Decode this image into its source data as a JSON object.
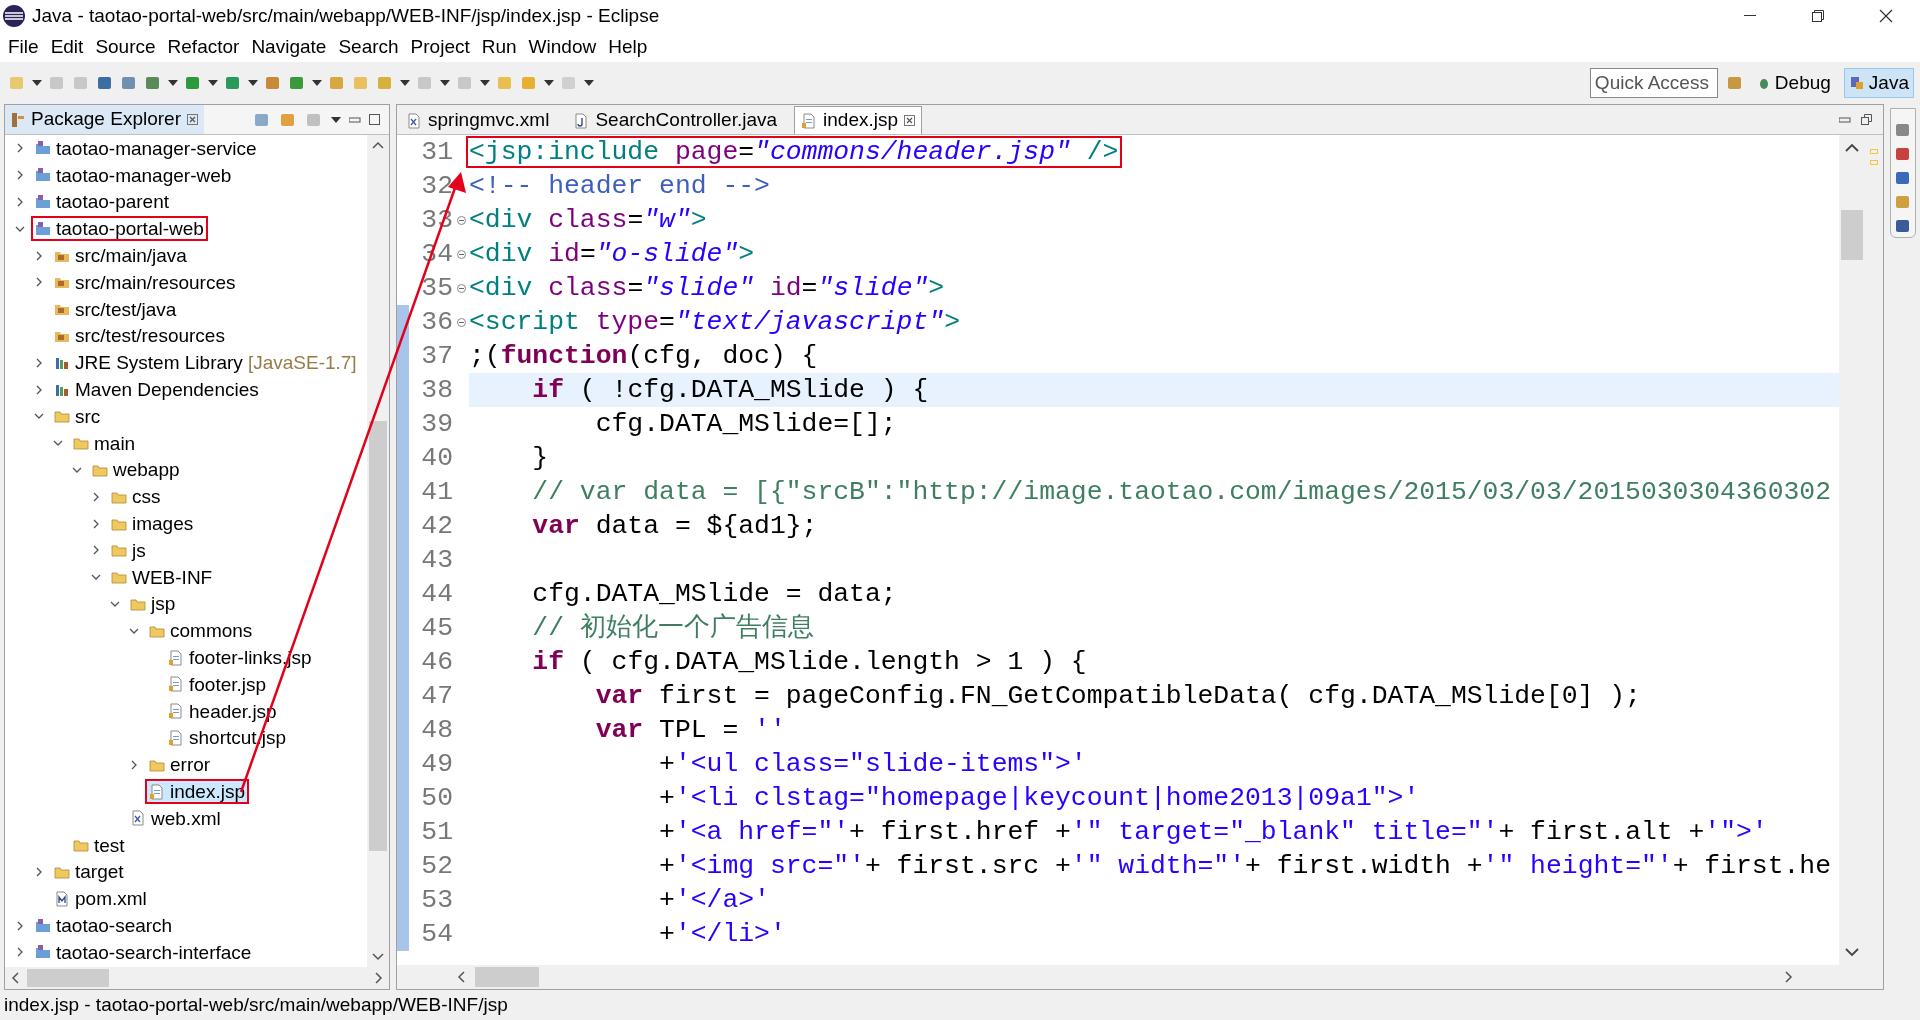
{
  "window": {
    "title": "Java - taotao-portal-web/src/main/webapp/WEB-INF/jsp/index.jsp - Eclipse"
  },
  "menu": [
    "File",
    "Edit",
    "Source",
    "Refactor",
    "Navigate",
    "Search",
    "Project",
    "Run",
    "Window",
    "Help"
  ],
  "quick_access": {
    "placeholder": "Quick Access"
  },
  "perspectives": [
    {
      "label": "Debug",
      "kind": "debug",
      "selected": false
    },
    {
      "label": "Java",
      "kind": "java",
      "selected": true
    }
  ],
  "package_explorer": {
    "title": "Package Explorer",
    "tree": [
      {
        "label": "taotao-manager-service",
        "kind": "project",
        "expanded": false,
        "selected": false,
        "annotated": false
      },
      {
        "label": "taotao-manager-web",
        "kind": "project",
        "expanded": false,
        "selected": false,
        "annotated": false
      },
      {
        "label": "taotao-parent",
        "kind": "project",
        "expanded": false,
        "selected": false,
        "annotated": false
      },
      {
        "label": "taotao-portal-web",
        "kind": "project",
        "expanded": true,
        "selected": false,
        "annotated": true,
        "children": [
          {
            "label": "src/main/java",
            "kind": "source",
            "expanded": false,
            "selected": false,
            "annotated": false
          },
          {
            "label": "src/main/resources",
            "kind": "source",
            "expanded": false,
            "selected": false,
            "annotated": false
          },
          {
            "label": "src/test/java",
            "kind": "source",
            "selected": false,
            "annotated": false
          },
          {
            "label": "src/test/resources",
            "kind": "source",
            "selected": false,
            "annotated": false
          },
          {
            "label": "JRE System Library",
            "decoration": "[JavaSE-1.7]",
            "kind": "library",
            "expanded": false,
            "selected": false,
            "annotated": false
          },
          {
            "label": "Maven Dependencies",
            "kind": "library",
            "expanded": false,
            "selected": false,
            "annotated": false
          },
          {
            "label": "src",
            "kind": "folder",
            "expanded": true,
            "selected": false,
            "annotated": false,
            "children": [
              {
                "label": "main",
                "kind": "folder",
                "expanded": true,
                "selected": false,
                "annotated": false,
                "children": [
                  {
                    "label": "webapp",
                    "kind": "folder",
                    "expanded": true,
                    "selected": false,
                    "annotated": false,
                    "children": [
                      {
                        "label": "css",
                        "kind": "folder",
                        "expanded": false,
                        "selected": false,
                        "annotated": false
                      },
                      {
                        "label": "images",
                        "kind": "folder",
                        "expanded": false,
                        "selected": false,
                        "annotated": false
                      },
                      {
                        "label": "js",
                        "kind": "folder",
                        "expanded": false,
                        "selected": false,
                        "annotated": false
                      },
                      {
                        "label": "WEB-INF",
                        "kind": "folder",
                        "expanded": true,
                        "selected": false,
                        "annotated": false,
                        "children": [
                          {
                            "label": "jsp",
                            "kind": "folder",
                            "expanded": true,
                            "selected": false,
                            "annotated": false,
                            "children": [
                              {
                                "label": "commons",
                                "kind": "folder",
                                "expanded": true,
                                "selected": false,
                                "annotated": false,
                                "children": [
                                  {
                                    "label": "footer-links.jsp",
                                    "kind": "jsp",
                                    "selected": false,
                                    "annotated": false
                                  },
                                  {
                                    "label": "footer.jsp",
                                    "kind": "jsp",
                                    "selected": false,
                                    "annotated": false
                                  },
                                  {
                                    "label": "header.jsp",
                                    "kind": "jsp",
                                    "selected": false,
                                    "annotated": false
                                  },
                                  {
                                    "label": "shortcut.jsp",
                                    "kind": "jsp",
                                    "selected": false,
                                    "annotated": false
                                  }
                                ]
                              },
                              {
                                "label": "error",
                                "kind": "folder",
                                "expanded": false,
                                "selected": false,
                                "annotated": false
                              },
                              {
                                "label": "index.jsp",
                                "kind": "jsp",
                                "selected": true,
                                "annotated": true
                              }
                            ]
                          },
                          {
                            "label": "web.xml",
                            "kind": "xml",
                            "selected": false,
                            "annotated": false
                          }
                        ]
                      }
                    ]
                  }
                ]
              },
              {
                "label": "test",
                "kind": "folder",
                "selected": false,
                "annotated": false
              }
            ]
          },
          {
            "label": "target",
            "kind": "folder",
            "expanded": false,
            "selected": false,
            "annotated": false
          },
          {
            "label": "pom.xml",
            "kind": "pom",
            "selected": false,
            "annotated": false
          }
        ]
      },
      {
        "label": "taotao-search",
        "kind": "project",
        "expanded": false,
        "selected": false,
        "annotated": false
      },
      {
        "label": "taotao-search-interface",
        "kind": "project",
        "expanded": false,
        "selected": false,
        "annotated": false
      }
    ]
  },
  "editor": {
    "tabs": [
      {
        "label": "springmvc.xml",
        "kind": "xml",
        "selected": false
      },
      {
        "label": "SearchController.java",
        "kind": "java",
        "selected": false
      },
      {
        "label": "index.jsp",
        "kind": "jsp",
        "selected": true
      }
    ],
    "lines": [
      {
        "number": "31",
        "current": false,
        "changed": false,
        "foldable": false,
        "annotated": true,
        "tokens": [
          {
            "kind": "tag",
            "text": "<jsp:include"
          },
          {
            "kind": "attr",
            "text": " page"
          },
          {
            "kind": "plain",
            "text": "="
          },
          {
            "kind": "value",
            "text": "\"commons/header.jsp\""
          },
          {
            "kind": "tag",
            "text": " />"
          }
        ]
      },
      {
        "number": "32",
        "current": false,
        "changed": false,
        "foldable": false,
        "annotated": false,
        "tokens": [
          {
            "kind": "markup-comment",
            "text": "<!-- header end -->"
          }
        ]
      },
      {
        "number": "33",
        "current": false,
        "changed": false,
        "foldable": true,
        "annotated": false,
        "tokens": [
          {
            "kind": "tag",
            "text": "<div"
          },
          {
            "kind": "attr",
            "text": " class"
          },
          {
            "kind": "plain",
            "text": "="
          },
          {
            "kind": "value",
            "text": "\"w\""
          },
          {
            "kind": "tag",
            "text": ">"
          }
        ]
      },
      {
        "number": "34",
        "current": false,
        "changed": false,
        "foldable": true,
        "annotated": false,
        "tokens": [
          {
            "kind": "tag",
            "text": "<div"
          },
          {
            "kind": "attr",
            "text": " id"
          },
          {
            "kind": "plain",
            "text": "="
          },
          {
            "kind": "value",
            "text": "\"o-slide\""
          },
          {
            "kind": "tag",
            "text": ">"
          }
        ]
      },
      {
        "number": "35",
        "current": false,
        "changed": false,
        "foldable": true,
        "annotated": false,
        "tokens": [
          {
            "kind": "tag",
            "text": "<div"
          },
          {
            "kind": "attr",
            "text": " class"
          },
          {
            "kind": "plain",
            "text": "="
          },
          {
            "kind": "value",
            "text": "\"slide\""
          },
          {
            "kind": "attr",
            "text": " id"
          },
          {
            "kind": "plain",
            "text": "="
          },
          {
            "kind": "value",
            "text": "\"slide\""
          },
          {
            "kind": "tag",
            "text": ">"
          }
        ]
      },
      {
        "number": "36",
        "current": false,
        "changed": true,
        "foldable": true,
        "annotated": false,
        "tokens": [
          {
            "kind": "tag",
            "text": "<script"
          },
          {
            "kind": "attr",
            "text": " type"
          },
          {
            "kind": "plain",
            "text": "="
          },
          {
            "kind": "value",
            "text": "\"text/javascript\""
          },
          {
            "kind": "tag",
            "text": ">"
          }
        ]
      },
      {
        "number": "37",
        "current": false,
        "changed": true,
        "foldable": false,
        "annotated": false,
        "tokens": [
          {
            "kind": "plain",
            "text": ";("
          },
          {
            "kind": "keyword",
            "text": "function"
          },
          {
            "kind": "plain",
            "text": "(cfg, doc) {"
          }
        ]
      },
      {
        "number": "38",
        "current": true,
        "changed": true,
        "foldable": false,
        "annotated": false,
        "tokens": [
          {
            "kind": "keyword",
            "text": "    if"
          },
          {
            "kind": "plain",
            "text": " ( !cfg.DATA_MSlide ) {"
          }
        ]
      },
      {
        "number": "39",
        "current": false,
        "changed": true,
        "foldable": false,
        "annotated": false,
        "tokens": [
          {
            "kind": "plain",
            "text": "        cfg.DATA_MSlide=[];"
          }
        ]
      },
      {
        "number": "40",
        "current": false,
        "changed": true,
        "foldable": false,
        "annotated": false,
        "tokens": [
          {
            "kind": "plain",
            "text": "    }"
          }
        ]
      },
      {
        "number": "41",
        "current": false,
        "changed": true,
        "foldable": false,
        "annotated": false,
        "tokens": [
          {
            "kind": "comment",
            "text": "    // var data = [{\"srcB\":\"http://image.taotao.com/images/2015/03/03/2015030304360302"
          }
        ]
      },
      {
        "number": "42",
        "current": false,
        "changed": true,
        "foldable": false,
        "annotated": false,
        "tokens": [
          {
            "kind": "keyword",
            "text": "    var"
          },
          {
            "kind": "plain",
            "text": " data = ${ad1};"
          }
        ]
      },
      {
        "number": "43",
        "current": false,
        "changed": true,
        "foldable": false,
        "annotated": false
      },
      {
        "number": "44",
        "current": false,
        "changed": true,
        "foldable": false,
        "annotated": false,
        "tokens": [
          {
            "kind": "plain",
            "text": "    cfg.DATA_MSlide = data;"
          }
        ]
      },
      {
        "number": "45",
        "current": false,
        "changed": true,
        "foldable": false,
        "annotated": false,
        "tokens": [
          {
            "kind": "comment",
            "text": "    // 初始化一个广告信息"
          }
        ]
      },
      {
        "number": "46",
        "current": false,
        "changed": true,
        "foldable": false,
        "annotated": false,
        "tokens": [
          {
            "kind": "keyword",
            "text": "    if"
          },
          {
            "kind": "plain",
            "text": " ( cfg.DATA_MSlide.length > 1 ) {"
          }
        ]
      },
      {
        "number": "47",
        "current": false,
        "changed": true,
        "foldable": false,
        "annotated": false,
        "tokens": [
          {
            "kind": "keyword",
            "text": "        var"
          },
          {
            "kind": "plain",
            "text": " first = pageConfig.FN_GetCompatibleData( cfg.DATA_MSlide[0] );"
          }
        ]
      },
      {
        "number": "48",
        "current": false,
        "changed": true,
        "foldable": false,
        "annotated": false,
        "tokens": [
          {
            "kind": "keyword",
            "text": "        var"
          },
          {
            "kind": "plain",
            "text": " TPL = "
          },
          {
            "kind": "string",
            "text": "''"
          }
        ]
      },
      {
        "number": "49",
        "current": false,
        "changed": true,
        "foldable": false,
        "annotated": false,
        "tokens": [
          {
            "kind": "plain",
            "text": "            +"
          },
          {
            "kind": "string",
            "text": "'<ul class=\"slide-items\">'"
          }
        ]
      },
      {
        "number": "50",
        "current": false,
        "changed": true,
        "foldable": false,
        "annotated": false,
        "tokens": [
          {
            "kind": "plain",
            "text": "            +"
          },
          {
            "kind": "string",
            "text": "'<li clstag=\"homepage|keycount|home2013|09a1\">'"
          }
        ]
      },
      {
        "number": "51",
        "current": false,
        "changed": true,
        "foldable": false,
        "annotated": false,
        "tokens": [
          {
            "kind": "plain",
            "text": "            +"
          },
          {
            "kind": "string",
            "text": "'<a href=\"'"
          },
          {
            "kind": "plain",
            "text": "+ first.href +"
          },
          {
            "kind": "string",
            "text": "'\" target=\"_blank\" title=\"'"
          },
          {
            "kind": "plain",
            "text": "+ first.alt +"
          },
          {
            "kind": "string",
            "text": "'\">'"
          }
        ]
      },
      {
        "number": "52",
        "current": false,
        "changed": true,
        "foldable": false,
        "annotated": false,
        "tokens": [
          {
            "kind": "plain",
            "text": "            +"
          },
          {
            "kind": "string",
            "text": "'<img src=\"'"
          },
          {
            "kind": "plain",
            "text": "+ first.src +"
          },
          {
            "kind": "string",
            "text": "'\" width=\"'"
          },
          {
            "kind": "plain",
            "text": "+ first.width +"
          },
          {
            "kind": "string",
            "text": "'\" height=\"'"
          },
          {
            "kind": "plain",
            "text": "+ first.he"
          }
        ]
      },
      {
        "number": "53",
        "current": false,
        "changed": true,
        "foldable": false,
        "annotated": false,
        "tokens": [
          {
            "kind": "plain",
            "text": "            +"
          },
          {
            "kind": "string",
            "text": "'</a>'"
          }
        ]
      },
      {
        "number": "54",
        "current": false,
        "changed": true,
        "foldable": false,
        "annotated": false,
        "tokens": [
          {
            "kind": "plain",
            "text": "            +"
          },
          {
            "kind": "string",
            "text": "'</li>'"
          }
        ]
      }
    ]
  },
  "status_bar": {
    "text": "index.jsp - taotao-portal-web/src/main/webapp/WEB-INF/jsp"
  }
}
